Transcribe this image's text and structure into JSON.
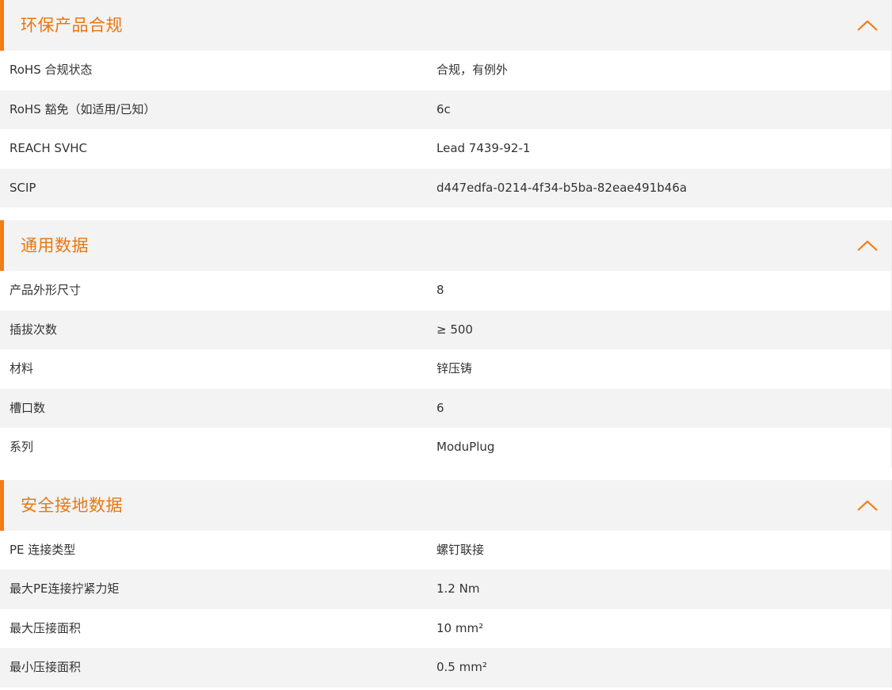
{
  "colors": {
    "accent": "#f07d16",
    "title_text": "#e87711",
    "row_even_bg": "#f3f3f3",
    "row_odd_bg": "#ffffff",
    "header_bg": "#f3f3f3",
    "body_text": "#333333"
  },
  "sections": [
    {
      "title": "环保产品合规",
      "toggle_icon": "chevron-up-icon",
      "rows": [
        {
          "label": "RoHS 合规状态",
          "value": "合规，有例外"
        },
        {
          "label": "RoHS 豁免（如适用/已知）",
          "value": "6c"
        },
        {
          "label": "REACH SVHC",
          "value": "Lead 7439-92-1"
        },
        {
          "label": "SCIP",
          "value": "d447edfa-0214-4f34-b5ba-82eae491b46a"
        }
      ]
    },
    {
      "title": "通用数据",
      "toggle_icon": "chevron-up-icon",
      "rows": [
        {
          "label": "产品外形尺寸",
          "value": "8"
        },
        {
          "label": "插拔次数",
          "value": "≥ 500"
        },
        {
          "label": "材料",
          "value": "锌压铸"
        },
        {
          "label": "槽口数",
          "value": "6"
        },
        {
          "label": "系列",
          "value": "ModuPlug"
        }
      ]
    },
    {
      "title": "安全接地数据",
      "toggle_icon": "chevron-up-icon",
      "rows": [
        {
          "label": "PE 连接类型",
          "value": "螺钉联接"
        },
        {
          "label": "最大PE连接拧紧力矩",
          "value": "1.2  Nm"
        },
        {
          "label": "最大压接面积",
          "value": "10  mm²"
        },
        {
          "label": "最小压接面积",
          "value": "0.5  mm²"
        }
      ]
    }
  ]
}
